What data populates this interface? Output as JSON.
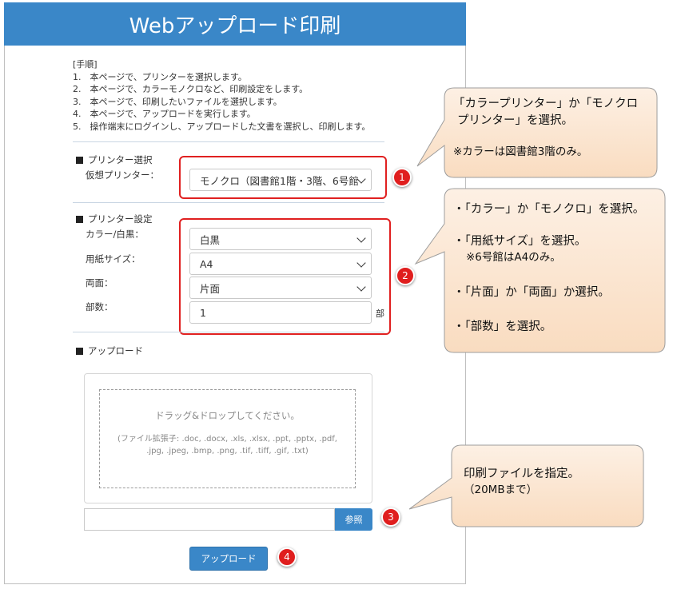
{
  "header": {
    "title": "Webアップロード印刷"
  },
  "steps": {
    "heading": "[手順]",
    "items": [
      "1.　本ページで、プリンターを選択します。",
      "2.　本ページで、カラーモノクロなど、印刷設定をします。",
      "3.　本ページで、印刷したいファイルを選択します。",
      "4.　本ページで、アップロードを実行します。",
      "5.　操作端末にログインし、アップロードした文書を選択し、印刷します。"
    ]
  },
  "printer_select": {
    "section_title": "プリンター選択",
    "virtual_printer_label": "仮想プリンター：",
    "virtual_printer_value": "モノクロ（図書館1階・3階、6号館"
  },
  "printer_settings": {
    "section_title": "プリンター設定",
    "color_label": "カラー/白黒：",
    "color_value": "白黒",
    "paper_label": "用紙サイズ：",
    "paper_value": "A4",
    "duplex_label": "両面：",
    "duplex_value": "片面",
    "copies_label": "部数：",
    "copies_value": "1",
    "copies_unit": "部"
  },
  "upload": {
    "section_title": "アップロード",
    "drop_title": "ドラッグ&ドロップしてください。",
    "drop_extensions": "(ファイル拡張子: .doc, .docx, .xls, .xlsx, .ppt, .pptx, .pdf, .jpg, .jpeg, .bmp, .png, .tif, .tiff, .gif, .txt)",
    "browse_label": "参照",
    "upload_button_label": "アップロード"
  },
  "badges": [
    "1",
    "2",
    "3",
    "4"
  ],
  "callouts": {
    "c1_line1": "「カラープリンター」か「モノクロ",
    "c1_line2": "プリンター」を選択。",
    "c1_note": "※カラーは図書館3階のみ。",
    "c2_line1": "・「カラー」か「モノクロ」を選択。",
    "c2_line2": "・「用紙サイズ」を選択。",
    "c2_line3": "※6号館はA4のみ。",
    "c2_line4": "・「片面」か「両面」か選択。",
    "c2_line5": "・「部数」を選択。",
    "c3_line1": "印刷ファイルを指定。",
    "c3_line2": "（20MBまで）"
  },
  "colors": {
    "header_bg": "#3a87c8",
    "button_bg": "#3a87c8",
    "highlight_red": "#e02020",
    "callout_fill": "#fbe5d0"
  }
}
